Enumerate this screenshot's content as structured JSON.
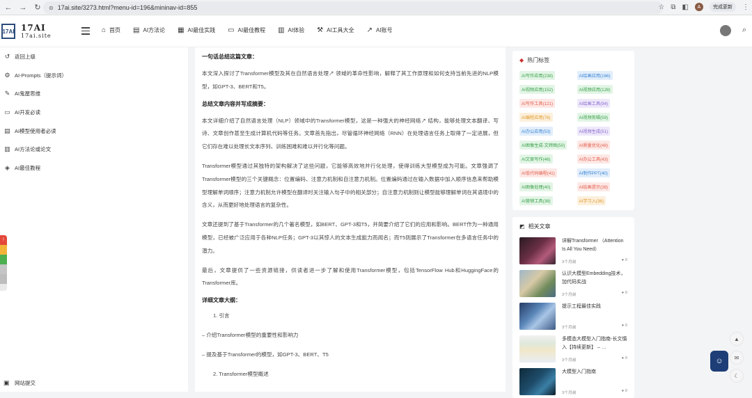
{
  "browser": {
    "url": "17ai.site/3273.html?menu-id=196&mininav-id=855",
    "profile_initial": "A",
    "update_label": "完成更新"
  },
  "header": {
    "logo_mark": "17AI",
    "logo_title": "17AI",
    "logo_sub": "17ai.site",
    "nav": [
      {
        "label": "首页",
        "icon": "home-icon",
        "glyph": "⌂"
      },
      {
        "label": "AI方法论",
        "icon": "book-icon",
        "glyph": "▤"
      },
      {
        "label": "AI最佳实践",
        "icon": "document-icon",
        "glyph": "▦"
      },
      {
        "label": "AI最佳教程",
        "icon": "monitor-icon",
        "glyph": "▭"
      },
      {
        "label": "AI体验",
        "icon": "book-open-icon",
        "glyph": "▥"
      },
      {
        "label": "AI工具大全",
        "icon": "tool-icon",
        "glyph": "⚒"
      },
      {
        "label": "AI账号",
        "icon": "external-link-icon",
        "glyph": "↗"
      }
    ]
  },
  "sidebar": {
    "items": [
      {
        "label": "返回上级",
        "glyph": "↺"
      },
      {
        "label": "AI-Prompts（提示词）",
        "glyph": "⚙"
      },
      {
        "label": "AI鬼屋思维",
        "glyph": "✎"
      },
      {
        "label": "AI开发必读",
        "glyph": "▭"
      },
      {
        "label": "AI模型使用者必读",
        "glyph": "▤"
      },
      {
        "label": "AI方法论或论文",
        "glyph": "▥"
      },
      {
        "label": "AI最佳教程",
        "glyph": "◈"
      }
    ],
    "bottom_label": "网站提交"
  },
  "article": {
    "h1": "一句话总结这篇文章：",
    "p1": "本文深入探讨了Transformer模型及其在自然语言处理↗ 领域的革命性影响，解释了其工作原理和如何支持当前先进的NLP模型，如GPT-3、BERT和T5。",
    "h2": "总结文章内容并写成摘要：",
    "p2": "本文详细介绍了自然语言处理（NLP）领域中的Transformer模型，这是一种强大的神经网络↗ 结构，能够处理文本翻译、写诗、文章创作甚至生成计算机代码等任务。文章首先指出，尽管循环神经网络（RNN）在处理语言任务上取得了一定进展，但它们存在难以处理长文本序列、训练困难和难以并行化等问题。",
    "p3": "Transformer模型通过其独特的架构解决了这些问题，它能够高效地并行化处理，使得训练大型模型成为可能。文章强调了Transformer模型的三个关键概念：位置编码、注意力机制和自注意力机制。位置编码通过在输入数据中加入顺序信息来帮助模型理解单词顺序；注意力机制允许模型在翻译时关注输入句子中的相关部分；自注意力机制则让模型能够理解单词在其语境中的含义，从而更好地处理语言的复杂性。",
    "p4": "文章还提到了基于Transformer的几个著名模型，如BERT、GPT-3和T5，并简要介绍了它们的应用和影响。BERT作为一种通用模型，已经被广泛应用于各种NLP任务；GPT-3以其惊人的文本生成能力而闻名；而T5则展示了Transformer在多语言任务中的潜力。",
    "p5": "最后，文章提供了一些资源链接，供读者进一步了解和使用Transformer模型，包括TensorFlow Hub和HuggingFace的Transformer库。",
    "h3": "详细文章大纲：",
    "o1": "1. 引言",
    "o2": "– 介绍Transformer模型的重要性和影响力",
    "o3": "– 提及基于Transformer的模型，如GPT-3、BERT、T5",
    "o4": "2. Transformer模型概述"
  },
  "hot_tags": {
    "title": "热门标签",
    "tags": [
      {
        "label": "AI写作应用(238)",
        "color": "#3aa14a",
        "bg": "#e3f5e6"
      },
      {
        "label": "AI绘画应用(166)",
        "color": "#3b86d6",
        "bg": "#e2eefb"
      },
      {
        "label": "AI视频应用(152)",
        "color": "#3aa14a",
        "bg": "#e3f5e6"
      },
      {
        "label": "AI视频应用(128)",
        "color": "#3aa14a",
        "bg": "#e3f5e6"
      },
      {
        "label": "AI写作工具(121)",
        "color": "#e2604f",
        "bg": "#fde8e5"
      },
      {
        "label": "AI绘画工具(94)",
        "color": "#8a6bd1",
        "bg": "#eee8fa"
      },
      {
        "label": "AI编程应用(76)",
        "color": "#e09a2c",
        "bg": "#fcf0dd"
      },
      {
        "label": "AI视频剪辑(59)",
        "color": "#3aa14a",
        "bg": "#e3f5e6"
      },
      {
        "label": "AI办公应用(53)",
        "color": "#3b86d6",
        "bg": "#e2eefb"
      },
      {
        "label": "AI视频生成(51)",
        "color": "#8a6bd1",
        "bg": "#eee8fa"
      },
      {
        "label": "AI图像生成-文转图(50)",
        "color": "#3aa14a",
        "bg": "#e3f5e6"
      },
      {
        "label": "AI质量优化(48)",
        "color": "#e2604f",
        "bg": "#fde8e5"
      },
      {
        "label": "AI文案写作(46)",
        "color": "#3aa14a",
        "bg": "#e3f5e6"
      },
      {
        "label": "AI办公工具(43)",
        "color": "#e2604f",
        "bg": "#fde8e5"
      },
      {
        "label": "AI低代码编程(41)",
        "color": "#e2604f",
        "bg": "#fde8e5"
      },
      {
        "label": "AI制作PPT(40)",
        "color": "#3b86d6",
        "bg": "#e2eefb"
      },
      {
        "label": "AI图像处理(40)",
        "color": "#3aa14a",
        "bg": "#e3f5e6"
      },
      {
        "label": "AI绘画提示(38)",
        "color": "#e2604f",
        "bg": "#fde8e5"
      },
      {
        "label": "AI营销工具(38)",
        "color": "#3aa14a",
        "bg": "#e3f5e6"
      },
      {
        "label": "AI学习入(36)",
        "color": "#e09a2c",
        "bg": "#fcf0dd"
      }
    ]
  },
  "related": {
    "title": "相关文章",
    "items": [
      {
        "title": "详解Transformer （Attention Is All You Need）",
        "time": "3个月前",
        "count": "0",
        "thumb": "linear-gradient(135deg,#2a1a22,#6a2f45 45%,#b35a7a 70%,#3a2430)"
      },
      {
        "title": "认识大模型Embedding技术，加代码实战",
        "time": "3个月前",
        "count": "0",
        "thumb": "linear-gradient(135deg,#9fb7c8,#d7c9a6 40%,#6f8a5a 70%,#4c6c86)"
      },
      {
        "title": "提示工程最佳实践",
        "time": "3个月前",
        "count": "0",
        "thumb": "linear-gradient(135deg,#263b66,#5a86b8 40%,#a9c6e6 60%,#3e5a86)"
      },
      {
        "title": "多模态大模型入门指南-长文慎入【持续更新】 – …",
        "time": "3个月前",
        "count": "0",
        "thumb": "linear-gradient(180deg,#f2f2f2,#dfe8da 30%,#f1e7c9 55%,#e9eef5)"
      },
      {
        "title": "大模型入门指南",
        "time": "3个月前",
        "count": "0",
        "thumb": "linear-gradient(135deg,#0f2a3a,#1e4c6a 45%,#3b7fa6 70%,#0c1c28)"
      }
    ]
  }
}
